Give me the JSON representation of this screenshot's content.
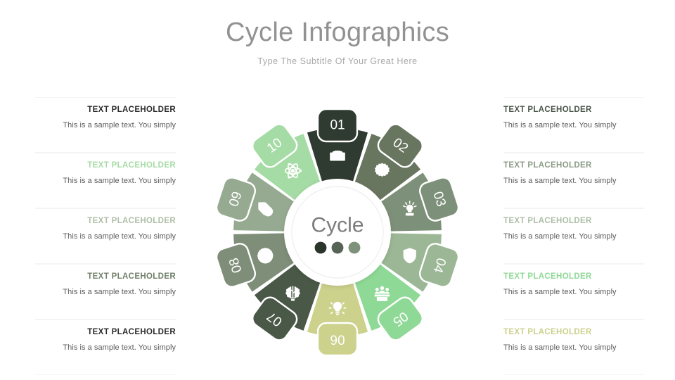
{
  "header": {
    "title": "Cycle Infographics",
    "subtitle": "Type The Subtitle Of Your Great Here"
  },
  "hub": {
    "label": "Cycle",
    "dots": [
      "#2b342b",
      "#566455",
      "#7d9279"
    ]
  },
  "chart_data": {
    "type": "pie",
    "title": "Cycle Infographics",
    "subtitle": "Type The Subtitle Of Your Great Here",
    "center_label": "Cycle",
    "segment_count": 10,
    "categories": [
      "01",
      "02",
      "03",
      "04",
      "05",
      "06",
      "07",
      "08",
      "09",
      "10"
    ],
    "values": [
      10,
      10,
      10,
      10,
      10,
      10,
      10,
      10,
      10,
      10
    ],
    "segments": [
      {
        "number": "01",
        "color": "#2f3a31",
        "icon": "camera-icon",
        "badge_color": "#2f3a31"
      },
      {
        "number": "02",
        "color": "#68755f",
        "icon": "gear-user-icon",
        "badge_color": "#68755f"
      },
      {
        "number": "03",
        "color": "#7d9079",
        "icon": "idea-hand-icon",
        "badge_color": "#7d9079"
      },
      {
        "number": "04",
        "color": "#9cb795",
        "icon": "shield-user-icon",
        "badge_color": "#9cb795"
      },
      {
        "number": "05",
        "color": "#8fd996",
        "icon": "team-desk-icon",
        "badge_color": "#8fd996"
      },
      {
        "number": "06",
        "color": "#ccd18c",
        "icon": "lightbulb-icon",
        "badge_color": "#ccd18c"
      },
      {
        "number": "07",
        "color": "#4a5847",
        "icon": "brain-icon",
        "badge_color": "#4a5847"
      },
      {
        "number": "08",
        "color": "#7f8e78",
        "icon": "clock-icon",
        "badge_color": "#7f8e78"
      },
      {
        "number": "09",
        "color": "#96aa91",
        "icon": "money-tag-icon",
        "badge_color": "#96aa91"
      },
      {
        "number": "10",
        "color": "#a5dba5",
        "icon": "atom-icon",
        "badge_color": "#a5dba5"
      }
    ],
    "legend_position": "sides",
    "grid": false
  },
  "left_blocks": [
    {
      "title": "TEXT PLACEHOLDER",
      "desc": "This is a sample text. You simply",
      "title_color": "#2b2b2b"
    },
    {
      "title": "TEXT PLACEHOLDER",
      "desc": "This is a sample text. You simply",
      "title_color": "#a5dba5"
    },
    {
      "title": "TEXT PLACEHOLDER",
      "desc": "This is a sample text. You simply",
      "title_color": "#adbfa6"
    },
    {
      "title": "TEXT PLACEHOLDER",
      "desc": "This is a sample text. You simply",
      "title_color": "#6f7f69"
    },
    {
      "title": "TEXT PLACEHOLDER",
      "desc": "This is a sample text. You simply",
      "title_color": "#2b2b2b"
    }
  ],
  "right_blocks": [
    {
      "title": "TEXT PLACEHOLDER",
      "desc": "This is a sample text. You simply",
      "title_color": "#4a564a"
    },
    {
      "title": "TEXT PLACEHOLDER",
      "desc": "This is a sample text. You simply",
      "title_color": "#8b9c86"
    },
    {
      "title": "TEXT PLACEHOLDER",
      "desc": "This is a sample text. You simply",
      "title_color": "#adbfa6"
    },
    {
      "title": "TEXT PLACEHOLDER",
      "desc": "This is a sample text. You simply",
      "title_color": "#8fd996"
    },
    {
      "title": "TEXT PLACEHOLDER",
      "desc": "This is a sample text. You simply",
      "title_color": "#ccd18c"
    }
  ]
}
